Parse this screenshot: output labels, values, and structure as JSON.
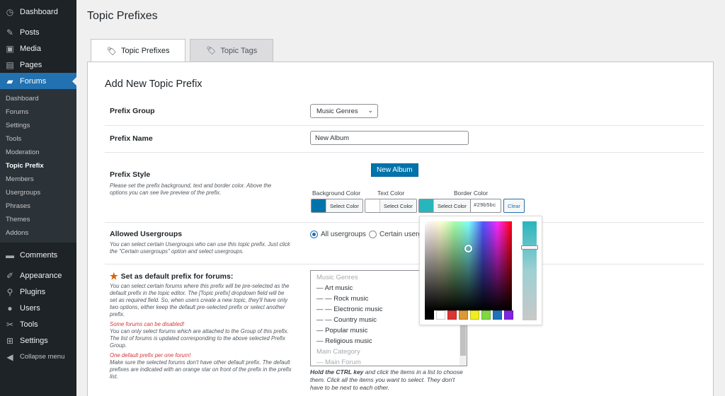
{
  "sidebar": {
    "top_items": [
      {
        "label": "Dashboard",
        "icon": "dashboard-icon"
      },
      {
        "label": "Posts",
        "icon": "pin-icon"
      },
      {
        "label": "Media",
        "icon": "media-icon"
      },
      {
        "label": "Pages",
        "icon": "page-icon"
      },
      {
        "label": "Forums",
        "icon": "forums-icon"
      }
    ],
    "sub_items": [
      "Dashboard",
      "Forums",
      "Settings",
      "Tools",
      "Moderation",
      "Topic Prefix",
      "Members",
      "Usergroups",
      "Phrases",
      "Themes",
      "Addons"
    ],
    "bottom_items": [
      {
        "label": "Comments",
        "icon": "comments-icon"
      },
      {
        "label": "Appearance",
        "icon": "appearance-icon"
      },
      {
        "label": "Plugins",
        "icon": "plugins-icon"
      },
      {
        "label": "Users",
        "icon": "users-icon"
      },
      {
        "label": "Tools",
        "icon": "tools-icon"
      },
      {
        "label": "Settings",
        "icon": "settings-icon"
      },
      {
        "label": "Collapse menu",
        "icon": "collapse-icon"
      }
    ]
  },
  "page": {
    "title": "Topic Prefixes",
    "tabs": [
      "Topic Prefixes",
      "Topic Tags"
    ],
    "section_title": "Add New Topic Prefix"
  },
  "form": {
    "prefix_group": {
      "label": "Prefix Group",
      "value": "Music Genres"
    },
    "prefix_name": {
      "label": "Prefix Name",
      "value": "New Album"
    },
    "prefix_style": {
      "label": "Prefix Style",
      "desc": "Please set the prefix background, text and border color. Above the options you can see live preview of the prefix.",
      "preview": "New Album",
      "bg_label": "Background Color",
      "text_label": "Text Color",
      "border_label": "Border Color",
      "select_color": "Select Color",
      "border_hex": "#29b5bc",
      "clear": "Clear",
      "colors": {
        "background": "#0073aa",
        "text": "#ffffff",
        "border": "#29b5bc"
      }
    },
    "allowed_usergroups": {
      "label": "Allowed Usergroups",
      "desc": "You can select certain Usergroups who can use this topic prefix. Just click the \"Certain usergroups\" option and select usergroups.",
      "opt_all": "All usergroups",
      "opt_certain": "Certain userg"
    },
    "default_prefix": {
      "label": "Set as default prefix for forums:",
      "desc1": "You can select certain forums where this prefix will be pre-selected as the default prefix in the topic editor. The [Topic prefix] dropdown field will be set as required field. So, when users create a new topic, they'll have only two options, either keep the default pre-selected prefix or select another prefix.",
      "warn1": "Some forums can be disabled!",
      "desc2": "You can only select forums which are attached to the Group of this prefix. The list of forums is updated corresponding to the above selected Prefix Group.",
      "warn2": "One default prefix per one forum!",
      "desc3": "Make sure the selected forums don't have other default prefix. The default prefixes are indicated with an orange star on front of the prefix in the prefix list.",
      "forums": [
        {
          "text": "Music Genres",
          "group": true
        },
        {
          "text": "— Art music",
          "group": false
        },
        {
          "text": "— — Rock music",
          "group": false
        },
        {
          "text": "— — Electronic music",
          "group": false
        },
        {
          "text": "— — Country music",
          "group": false
        },
        {
          "text": "— Popular music",
          "group": false
        },
        {
          "text": "— Religious music",
          "group": false
        },
        {
          "text": "Main Category",
          "group": true
        },
        {
          "text": "— Main Forum",
          "group": true
        }
      ],
      "hint_bold": "Hold the CTRL key",
      "hint_rest": " and click the items in a list to choose them. Click all the items you want to select. They don't have to be next to each other."
    }
  },
  "palette": [
    "#000000",
    "#ffffff",
    "#dd3333",
    "#dd9933",
    "#eeee22",
    "#81d742",
    "#1e73be",
    "#8224e3"
  ]
}
